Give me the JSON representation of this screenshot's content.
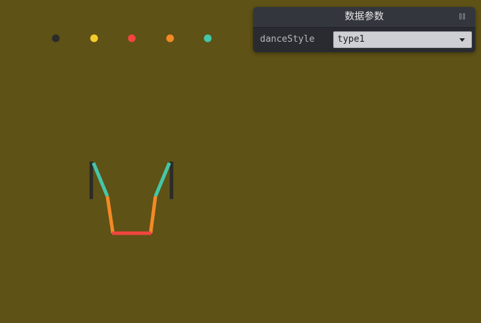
{
  "scene": {
    "background": "#5e5216",
    "palette": [
      "#2b2b2b",
      "#f5cc2e",
      "#f2453f",
      "#f28a25",
      "#45c6a8"
    ]
  },
  "gui": {
    "title": "数据参数",
    "collapse_icon": "pause-icon",
    "controls": [
      {
        "label": "danceStyle",
        "value": "type1",
        "arrow_icon": "chevron-down-icon"
      }
    ]
  }
}
